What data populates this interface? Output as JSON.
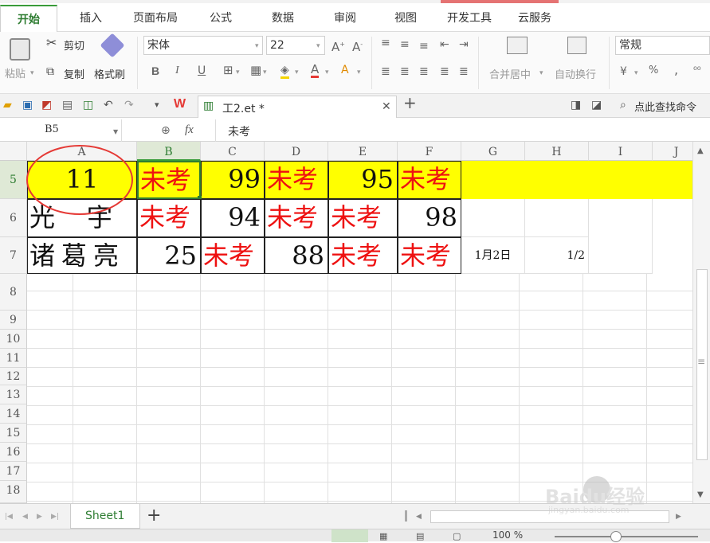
{
  "menu": {
    "tabs": [
      "开始",
      "插入",
      "页面布局",
      "公式",
      "数据",
      "审阅",
      "视图",
      "开发工具",
      "云服务"
    ]
  },
  "ribbon": {
    "paste": "粘贴",
    "cut": "剪切",
    "copy": "复制",
    "format_painter": "格式刷",
    "font_name": "宋体",
    "font_size": "22",
    "merge_center": "合并居中",
    "wrap_text": "自动换行",
    "number_format": "常规",
    "percent": "%",
    "comma": ","
  },
  "quickbar": {
    "doc_tab": "工2.et *",
    "find_command": "点此查找命令"
  },
  "formula_bar": {
    "name_box": "B5",
    "fx": "fx",
    "content": "未考"
  },
  "grid": {
    "columns": [
      "A",
      "B",
      "C",
      "D",
      "E",
      "F",
      "G",
      "H",
      "I",
      "J"
    ],
    "rows": [
      "5",
      "6",
      "7",
      "8",
      "9",
      "10",
      "11",
      "12",
      "13",
      "14",
      "15",
      "16",
      "17",
      "18"
    ],
    "r5": {
      "A": "11",
      "B": "未考",
      "C": "99",
      "D": "未考",
      "E": "95",
      "F": "未考"
    },
    "r6": {
      "A": "光　宇",
      "B": "未考",
      "C": "94",
      "D": "未考",
      "E": "未考",
      "F": "98"
    },
    "r7": {
      "A": "诸葛亮",
      "B": "25",
      "C": "未考",
      "D": "88",
      "E": "未考",
      "F": "未考",
      "G": "1月2日",
      "H": "1/2"
    }
  },
  "sheetbar": {
    "sheet_tab": "Sheet1",
    "add": "+"
  },
  "statusbar": {
    "zoom": "100 %"
  },
  "watermark": {
    "brand": "Baidu经验",
    "url": "jingyan.baidu.com"
  },
  "colors": {
    "accent": "#3a9c3a",
    "highlight": "#ffff00",
    "red_text": "#ee1111",
    "annotation": "#e53935"
  }
}
